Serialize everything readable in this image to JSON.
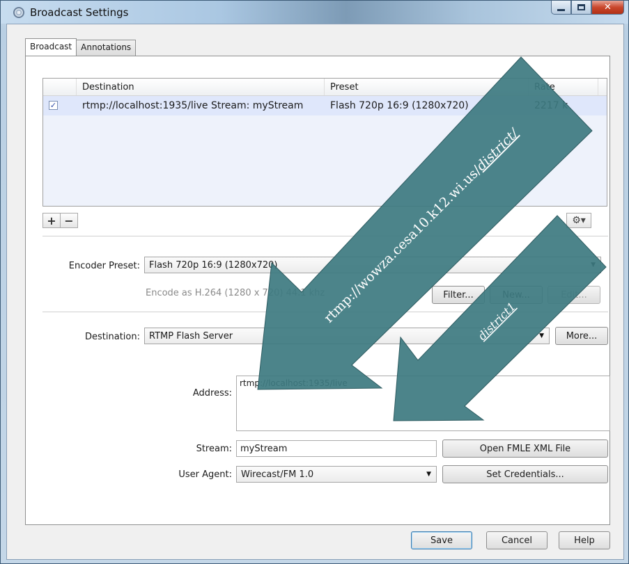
{
  "window": {
    "title": "Broadcast Settings"
  },
  "tabs": [
    {
      "label": "Broadcast"
    },
    {
      "label": "Annotations"
    }
  ],
  "table": {
    "headers": {
      "destination": "Destination",
      "preset": "Preset",
      "rate": "Rate"
    },
    "rows": [
      {
        "checked": true,
        "destination": "rtmp://localhost:1935/live Stream: myStream",
        "preset": "Flash 720p 16:9 (1280x720)",
        "rate": "2217 k"
      }
    ]
  },
  "encoder": {
    "label": "Encoder Preset:",
    "value": "Flash 720p 16:9 (1280x720)",
    "hint": "Encode as H.264 (1280 x 720) 44.1 khz",
    "filter_label": "Filter...",
    "new_label": "New...",
    "edit_label": "Edit..."
  },
  "destination": {
    "label": "Destination:",
    "value": "RTMP Flash Server",
    "more_label": "More..."
  },
  "address": {
    "label": "Address:",
    "value": "rtmp://localhost:1935/live"
  },
  "stream": {
    "label": "Stream:",
    "value": "myStream",
    "open_label": "Open FMLE XML File"
  },
  "user_agent": {
    "label": "User Agent:",
    "value": "Wirecast/FM 1.0",
    "credentials_label": "Set Credentials..."
  },
  "footer": {
    "save_label": "Save",
    "cancel_label": "Cancel",
    "help_label": "Help"
  },
  "annotations": {
    "arrow1_text": "rtmp://wowza.cesa10.k12.wi.us/",
    "arrow1_link": "district/",
    "arrow2_text": "district1"
  },
  "colors": {
    "arrow_fill": "#3d7a80",
    "selected_row": "#dfe7fb"
  }
}
